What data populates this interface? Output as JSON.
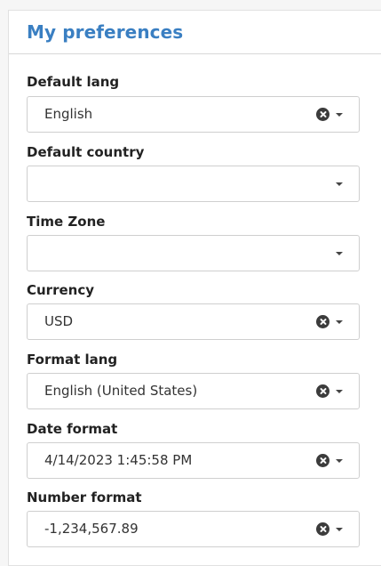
{
  "panel": {
    "title": "My preferences"
  },
  "fields": {
    "default_lang": {
      "label": "Default lang",
      "value": "English"
    },
    "default_country": {
      "label": "Default country",
      "value": ""
    },
    "time_zone": {
      "label": "Time Zone",
      "value": ""
    },
    "currency": {
      "label": "Currency",
      "value": "USD"
    },
    "format_lang": {
      "label": "Format lang",
      "value": "English (United States)"
    },
    "date_format": {
      "label": "Date format",
      "value": "4/14/2023 1:45:58 PM"
    },
    "number_format": {
      "label": "Number format",
      "value": "-1,234,567.89"
    }
  },
  "colors": {
    "title": "#3a7fc2",
    "border": "#cfcfcf"
  },
  "icons": {
    "clear": "clear-icon",
    "dropdown": "chevron-down-icon"
  }
}
